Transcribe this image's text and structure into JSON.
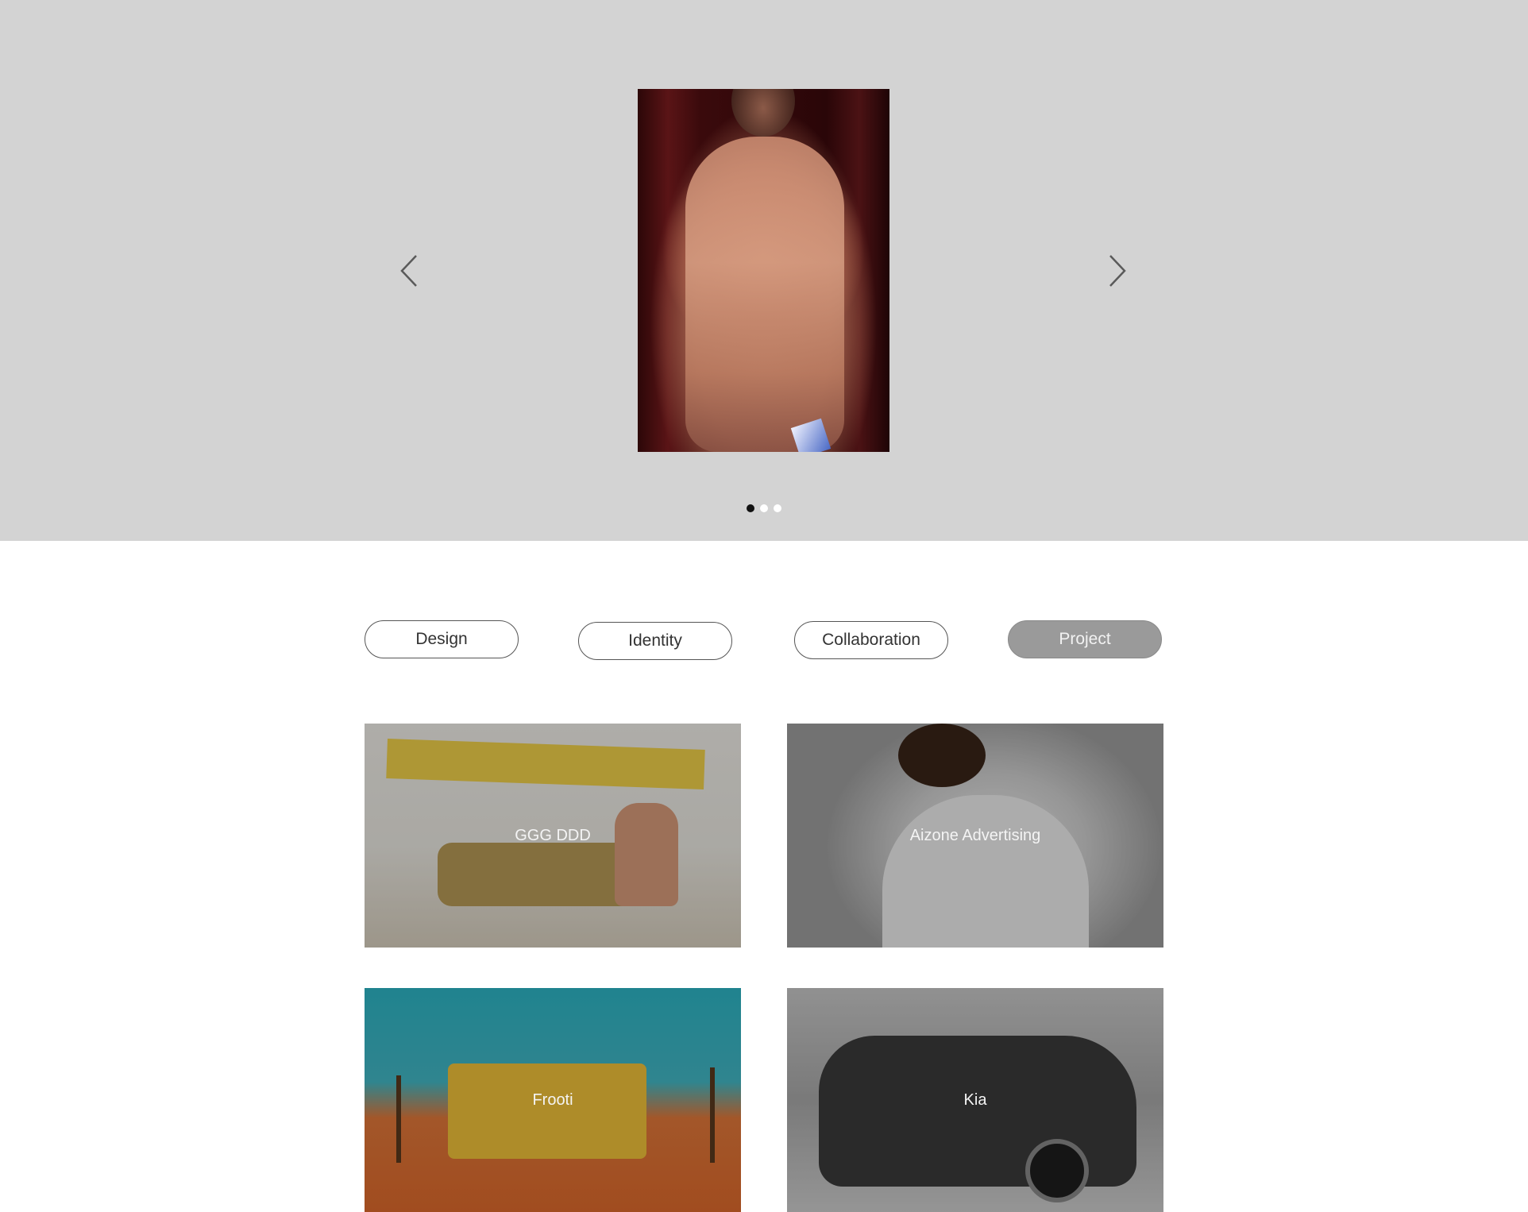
{
  "hero": {
    "slides_total": 3,
    "active_slide": 1,
    "prev_label": "previous",
    "next_label": "next"
  },
  "filters": {
    "design": "Design",
    "identity": "Identity",
    "collaboration": "Collaboration",
    "project": "Project",
    "active": "Project"
  },
  "projects": [
    {
      "title": "GGG DDD"
    },
    {
      "title": "Aizone  Advertising"
    },
    {
      "title": "Frooti"
    },
    {
      "title": "Kia"
    }
  ],
  "icons": {
    "prev": "chevron-left-icon",
    "next": "chevron-right-icon"
  },
  "colors": {
    "hero_bg": "#d3d3d3",
    "active_filter_bg": "#9a9a9a",
    "dot_active": "#111111",
    "dot_inactive": "#ffffff"
  }
}
